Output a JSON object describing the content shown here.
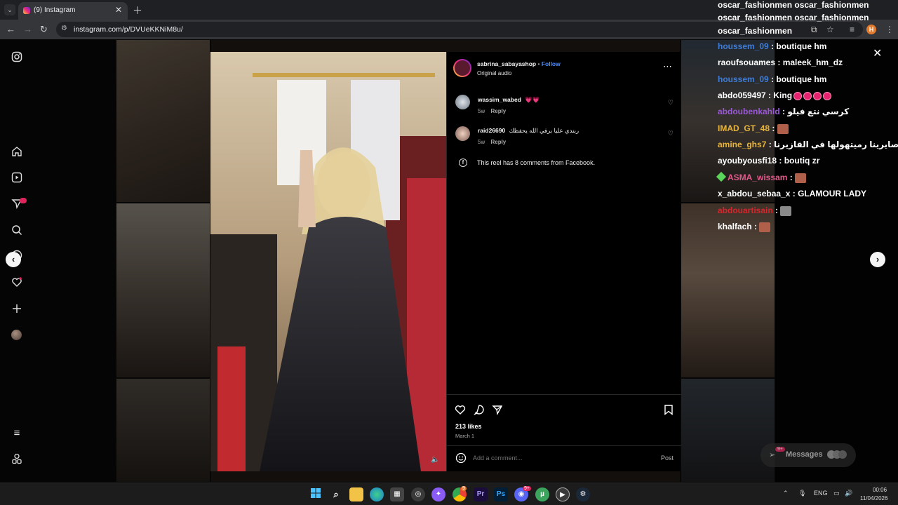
{
  "browser": {
    "tab_title": "(9) Instagram",
    "url": "instagram.com/p/DVUeKKNiM8u/",
    "profile_initial": "H",
    "tab_list_icon": "chevron-down-icon",
    "new_tab_icon": "plus-icon"
  },
  "instagram": {
    "sidebar_badge": "9+",
    "post": {
      "username": "sabrina_sabayashop",
      "follow_label": "Follow",
      "audio": "Original audio",
      "comments": [
        {
          "user": "wassim_wabed",
          "text": "💗💗",
          "age": "5w",
          "reply": "Reply"
        },
        {
          "user": "raid26690",
          "text": "ربندي عليا برفي الله يحفظك",
          "age": "5w",
          "reply": "Reply"
        }
      ],
      "facebook_note": "This reel has 8 comments from Facebook.",
      "likes": "213 likes",
      "date": "March 1",
      "comment_placeholder": "Add a comment...",
      "post_button": "Post"
    },
    "messages": {
      "label": "Messages",
      "badge": "9+"
    }
  },
  "chat": {
    "header_lines": [
      "oscar_fashionmen oscar_fashionmen",
      "oscar_fashionmen oscar_fashionmen",
      "oscar_fashionmen"
    ],
    "messages": [
      {
        "user": "houssem_09",
        "sep": " : ",
        "text": "boutique hm",
        "color": "#3f7cd6"
      },
      {
        "user": "raoufsouames",
        "sep": " : ",
        "text": "maleek_hm_dz",
        "color": "#ffffff"
      },
      {
        "user": "houssem_09",
        "sep": " : ",
        "text": "boutique hm",
        "color": "#3f7cd6"
      },
      {
        "user": "abdo059497",
        "sep": " : ",
        "text": "King",
        "color": "#ffffff"
      },
      {
        "user": "abdoubenkahld",
        "sep": " : ",
        "text": "كرسي نتع فيلو",
        "color": "#9b59d6"
      },
      {
        "user": "IMAD_GT_48",
        "sep": " : ",
        "text": "",
        "color": "#e8b53a"
      },
      {
        "user": "amine_ghs7",
        "sep": " : ",
        "text": "صايرينا رميتهولها في القازيرنا",
        "color": "#e8b53a"
      },
      {
        "user": "ayoubyousfi18",
        "sep": " : ",
        "text": "boutiq zr",
        "color": "#ffffff"
      },
      {
        "user": "ASMA_wissam",
        "sep": " : ",
        "text": "",
        "color": "#e05a8a"
      },
      {
        "user": "x_abdou_sebaa_x",
        "sep": " : ",
        "text": "GLAMOUR LADY",
        "color": "#ffffff"
      },
      {
        "user": "abdouartisain",
        "sep": " : ",
        "text": "",
        "color": "#d9252b"
      },
      {
        "user": "khalfach",
        "sep": " : ",
        "text": "",
        "color": "#ffffff"
      }
    ]
  },
  "taskbar": {
    "language": "ENG",
    "time": "00:06",
    "date": "11/04/2026",
    "chrome_badge": "9",
    "discord_badge": "9+"
  },
  "colors": {
    "instagram_blue": "#4a8cff",
    "heart_pink": "#ff3b83"
  }
}
